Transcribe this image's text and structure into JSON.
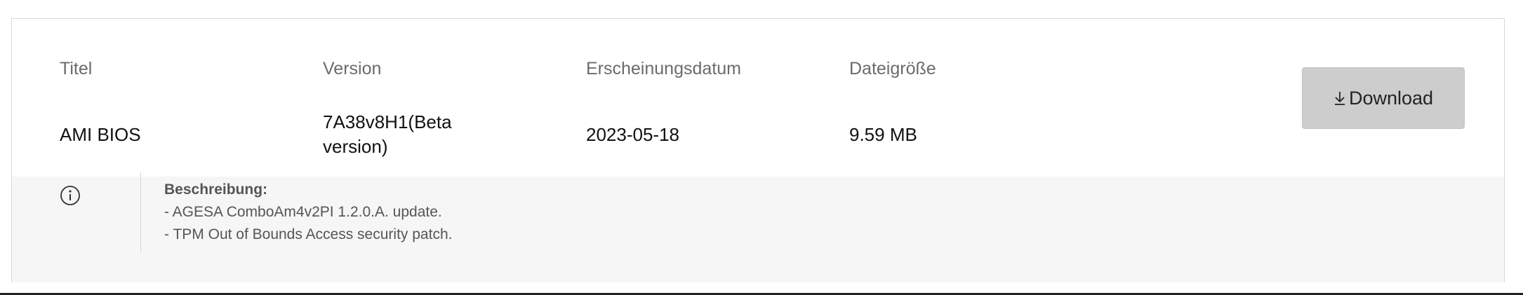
{
  "columns": {
    "title": {
      "label": "Titel",
      "value": "AMI BIOS"
    },
    "version": {
      "label": "Version",
      "value": "7A38v8H1(Beta version)"
    },
    "release_date": {
      "label": "Erscheinungsdatum",
      "value": "2023-05-18"
    },
    "file_size": {
      "label": "Dateigröße",
      "value": "9.59 MB"
    }
  },
  "download": {
    "label": "Download",
    "icon": "download-arrow-icon"
  },
  "description": {
    "icon": "info-icon",
    "title": "Beschreibung:",
    "lines": [
      "- AGESA ComboAm4v2PI 1.2.0.A. update.",
      "- TPM Out of Bounds Access security patch."
    ]
  },
  "colors": {
    "button_bg": "#cdcdcd",
    "description_bg": "#f6f6f6",
    "label_text": "#6b6b6b",
    "value_text": "#111111"
  }
}
